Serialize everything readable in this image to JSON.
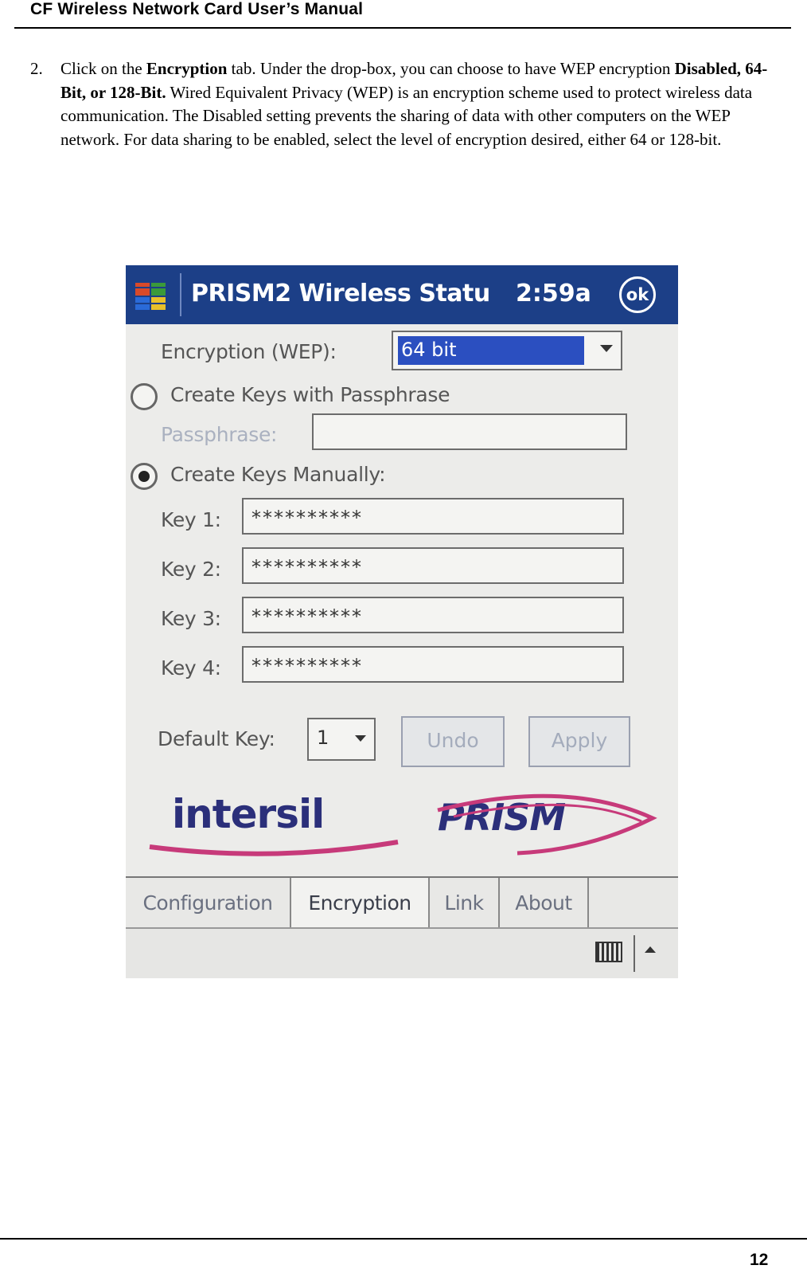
{
  "header": {
    "title": "CF Wireless Network Card User’s Manual"
  },
  "step": {
    "number": "2.",
    "text_1": "Click on the ",
    "bold_1": "Encryption",
    "text_2": " tab. Under the drop-box, you can choose to have WEP encryption ",
    "bold_2": "Disabled, 64-Bit, or 128-Bit.",
    "text_3": " Wired Equivalent Privacy (WEP) is an encryption scheme used to protect wireless data communication. The Disabled setting prevents the sharing of data with other computers on the WEP network. For data sharing to be enabled, select the level of encryption desired, either 64 or 128-bit."
  },
  "screenshot": {
    "title": "PRISM2 Wireless Statu",
    "time": "2:59a",
    "ok_label": "ok",
    "encryption_label": "Encryption (WEP):",
    "encryption_value": "64 bit",
    "radio_passphrase": "Create Keys with Passphrase",
    "passphrase_label": "Passphrase:",
    "passphrase_value": "",
    "radio_manual": "Create Keys Manually:",
    "keys": [
      {
        "label": "Key 1:",
        "value": "**********"
      },
      {
        "label": "Key 2:",
        "value": "**********"
      },
      {
        "label": "Key 3:",
        "value": "**********"
      },
      {
        "label": "Key 4:",
        "value": "**********"
      }
    ],
    "default_key_label": "Default Key:",
    "default_key_value": "1",
    "undo_label": "Undo",
    "apply_label": "Apply",
    "logo_intersil": "intersil",
    "logo_prism": "PRISM",
    "tabs": [
      {
        "label": "Configuration"
      },
      {
        "label": "Encryption"
      },
      {
        "label": "Link"
      },
      {
        "label": "About"
      }
    ],
    "active_tab": "Encryption"
  },
  "footer": {
    "page_number": "12"
  },
  "colors": {
    "titlebar": "#1c3f87",
    "logo": "#2b2f7a",
    "swoosh": "#c73a7a",
    "selection": "#2b4fc0"
  }
}
